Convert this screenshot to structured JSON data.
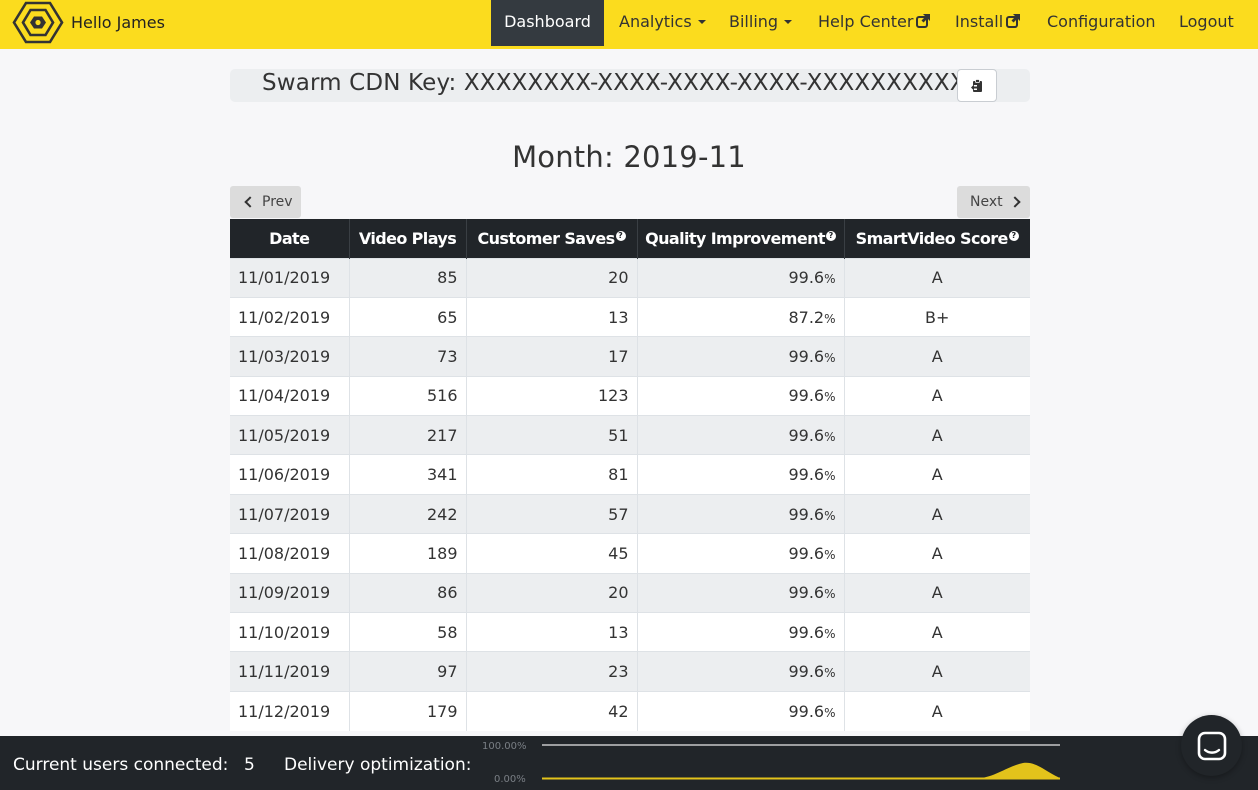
{
  "nav": {
    "greeting": "Hello James",
    "items": [
      {
        "label": "Dashboard",
        "active": true
      },
      {
        "label": "Analytics",
        "dropdown": true
      },
      {
        "label": "Billing",
        "dropdown": true
      },
      {
        "label": "Help Center",
        "external": true
      },
      {
        "label": "Install",
        "external": true
      },
      {
        "label": "Configuration"
      },
      {
        "label": "Logout"
      }
    ]
  },
  "cdn_key": {
    "label": "Swarm CDN Key: XXXXXXXX-XXXX-XXXX-XXXX-XXXXXXXXXXXX"
  },
  "month": {
    "title": "Month: 2019-11",
    "prev_label": "Prev",
    "next_label": "Next"
  },
  "table": {
    "headers": [
      "Date",
      "Video Plays",
      "Customer Saves",
      "Quality Improvement",
      "SmartVideo Score"
    ],
    "help_icon": "?",
    "percent_sign": "%",
    "rows": [
      {
        "date": "11/01/2019",
        "plays": "85",
        "saves": "20",
        "quality": "99.6",
        "score": "A"
      },
      {
        "date": "11/02/2019",
        "plays": "65",
        "saves": "13",
        "quality": "87.2",
        "score": "B+"
      },
      {
        "date": "11/03/2019",
        "plays": "73",
        "saves": "17",
        "quality": "99.6",
        "score": "A"
      },
      {
        "date": "11/04/2019",
        "plays": "516",
        "saves": "123",
        "quality": "99.6",
        "score": "A"
      },
      {
        "date": "11/05/2019",
        "plays": "217",
        "saves": "51",
        "quality": "99.6",
        "score": "A"
      },
      {
        "date": "11/06/2019",
        "plays": "341",
        "saves": "81",
        "quality": "99.6",
        "score": "A"
      },
      {
        "date": "11/07/2019",
        "plays": "242",
        "saves": "57",
        "quality": "99.6",
        "score": "A"
      },
      {
        "date": "11/08/2019",
        "plays": "189",
        "saves": "45",
        "quality": "99.6",
        "score": "A"
      },
      {
        "date": "11/09/2019",
        "plays": "86",
        "saves": "20",
        "quality": "99.6",
        "score": "A"
      },
      {
        "date": "11/10/2019",
        "plays": "58",
        "saves": "13",
        "quality": "99.6",
        "score": "A"
      },
      {
        "date": "11/11/2019",
        "plays": "97",
        "saves": "23",
        "quality": "99.6",
        "score": "A"
      },
      {
        "date": "11/12/2019",
        "plays": "179",
        "saves": "42",
        "quality": "99.6",
        "score": "A"
      }
    ]
  },
  "footer": {
    "users_label": "Current users connected:",
    "users_value": "5",
    "delivery_label": "Delivery optimization:",
    "spark_top": "100.00%",
    "spark_bottom": "0.00%"
  },
  "colors": {
    "brand": "#fbdc1e",
    "dark": "#212529",
    "spark_fill": "#e3c31b"
  },
  "icons": [
    "hexagon-logo-icon",
    "caret-down-icon",
    "external-link-icon",
    "clipboard-icon",
    "chevron-left-icon",
    "chevron-right-icon",
    "help-icon",
    "chat-icon"
  ]
}
